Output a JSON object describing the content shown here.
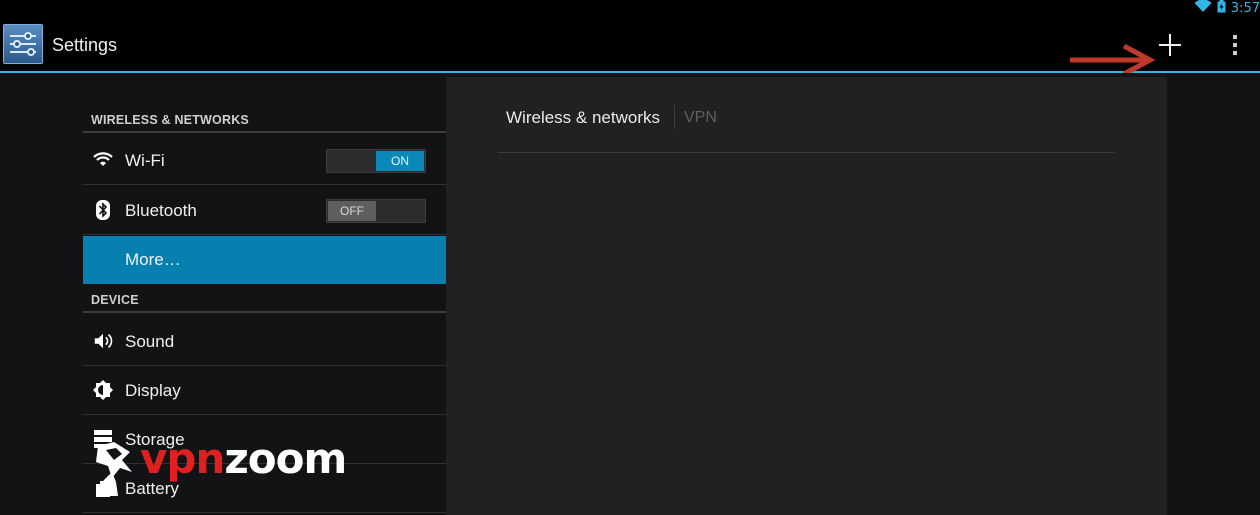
{
  "status_bar": {
    "time": "3:57",
    "icons": [
      "wifi-icon",
      "battery-charging-icon"
    ],
    "accent_color": "#33b5e5"
  },
  "action_bar": {
    "title": "Settings",
    "app_icon": "settings-sliders-icon",
    "actions": [
      "plus-icon",
      "overflow-menu-icon"
    ]
  },
  "sidebar": {
    "sections": [
      {
        "header": "WIRELESS & NETWORKS",
        "items": [
          {
            "label": "Wi-Fi",
            "icon": "wifi-icon",
            "toggle": "ON"
          },
          {
            "label": "Bluetooth",
            "icon": "bluetooth-icon",
            "toggle": "OFF"
          },
          {
            "label": "More…",
            "selected": true
          }
        ]
      },
      {
        "header": "DEVICE",
        "items": [
          {
            "label": "Sound",
            "icon": "speaker-icon"
          },
          {
            "label": "Display",
            "icon": "brightness-icon"
          },
          {
            "label": "Storage",
            "icon": "storage-icon"
          },
          {
            "label": "Battery",
            "icon": "battery-icon"
          }
        ]
      }
    ],
    "selected_color": "#0780b0"
  },
  "detail": {
    "breadcrumb_main": "Wireless & networks",
    "breadcrumb_sub": "VPN"
  },
  "watermark": {
    "part1": "vpn",
    "part2": "zoom"
  }
}
